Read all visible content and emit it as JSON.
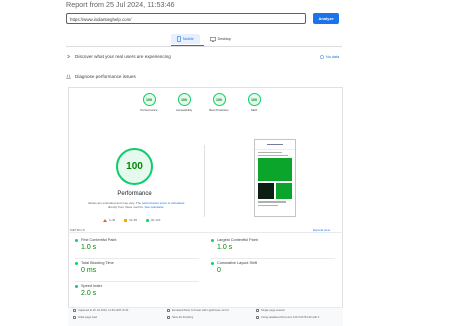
{
  "header": {
    "report_title": "Report from 25 Jul 2024, 11:53:46"
  },
  "search": {
    "url": "https://www.indiantieghelp.com/",
    "analyze_label": "Analyze"
  },
  "device_tabs": [
    {
      "label": "Mobile",
      "icon": "mobile-icon",
      "active": true
    },
    {
      "label": "Desktop",
      "icon": "desktop-icon",
      "active": false
    }
  ],
  "field_data": {
    "title": "Discover what your real users are experiencing",
    "status": "No data"
  },
  "diagnose": {
    "title": "Diagnose performance issues"
  },
  "categories": [
    {
      "label": "Performance",
      "score": "100"
    },
    {
      "label": "Accessibility",
      "score": "100"
    },
    {
      "label": "Best Practices",
      "score": "100"
    },
    {
      "label": "SEO",
      "score": "100"
    }
  ],
  "performance": {
    "score": "100",
    "title": "Performance",
    "note_start": "Values are estimated and may vary. The",
    "note_link1": "performance score is calculated",
    "note_mid": "directly from these metrics.",
    "note_link2": "See calculator."
  },
  "legend": [
    {
      "range": "0–49",
      "shape": "triangle",
      "color": "#ff4e42"
    },
    {
      "range": "50–89",
      "shape": "square",
      "color": "#ffa400"
    },
    {
      "range": "90–100",
      "shape": "circle",
      "color": "#0cce6b"
    }
  ],
  "metrics_section": {
    "label": "METRICS",
    "expand": "Expand view"
  },
  "metrics": [
    {
      "name": "First Contentful Paint",
      "value": "1.0 s"
    },
    {
      "name": "Largest Contentful Paint",
      "value": "1.0 s"
    },
    {
      "name": "Total Blocking Time",
      "value": "0 ms"
    },
    {
      "name": "Cumulative Layout Shift",
      "value": "0"
    },
    {
      "name": "Speed Index",
      "value": "2.0 s"
    }
  ],
  "footer": {
    "captured": "Captured at 25 Jul 2024, 11:53 GMT+5:30",
    "emulated": "Emulated Moto G Power with Lighthouse 12.0.0",
    "session": "Single page session",
    "initial_load": "Initial page load",
    "throttling": "Slow 4G throttling",
    "browser": "Using HeadlessChromium 126.0.6478.126 with lr"
  },
  "colors": {
    "accent": "#1a73e8",
    "pass": "#0cce6b",
    "pass_text": "#008800"
  }
}
